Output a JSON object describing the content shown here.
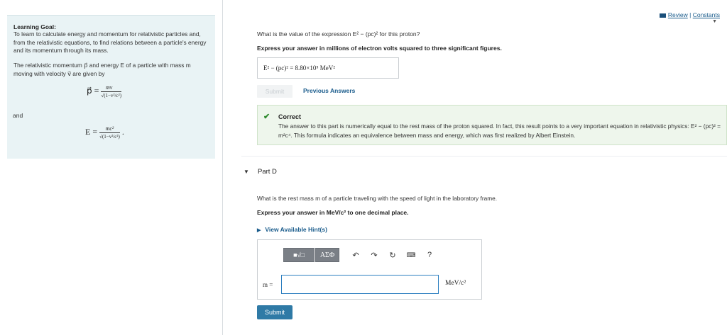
{
  "goal": {
    "title": "Learning Goal:",
    "text": "To learn to calculate energy and momentum for relativistic particles and, from the relativistic equations, to find relations between a particle's energy and its momentum through its mass.",
    "intro": "The relativistic momentum p⃗ and energy E of a particle with mass m moving with velocity v⃗ are given by",
    "formula_p_lhs": "p⃗ =",
    "formula_p_num": "mv⃗",
    "formula_p_den": "√(1−v²/c²)",
    "and_label": "and",
    "formula_e_lhs": "E =",
    "formula_e_num": "mc²",
    "formula_e_den": "√(1−v²/c²)",
    "formula_e_tail": "."
  },
  "links": {
    "review": "Review",
    "sep": "|",
    "constants": "Constants"
  },
  "partC": {
    "question": "What is the value of the expression E² − (pc)² for this proton?",
    "instruction": "Express your answer in millions of electron volts squared to three significant figures.",
    "answer": "E² − (pc)² = 8.80×10⁵ MeV²",
    "submit_label": "Submit",
    "prev_answers_label": "Previous Answers",
    "correct_title": "Correct",
    "correct_text": "The answer to this part is numerically equal to the rest mass of the proton squared. In fact, this result points to a very important equation in relativistic physics: E² − (pc)² = m²c⁴. This formula indicates an equivalence between mass and energy, which was first realized by Albert Einstein."
  },
  "partD": {
    "title": "Part D",
    "question": "What is the rest mass m of a particle traveling with the speed of light in the laboratory frame.",
    "instruction": "Express your answer in MeV/c² to one decimal place.",
    "hints_label": "View Available Hint(s)",
    "toolbar_math": "■√□",
    "toolbar_greek": "AΣΦ",
    "m_label": "m =",
    "input_value": "",
    "unit": "MeV/c²",
    "submit_label": "Submit"
  }
}
